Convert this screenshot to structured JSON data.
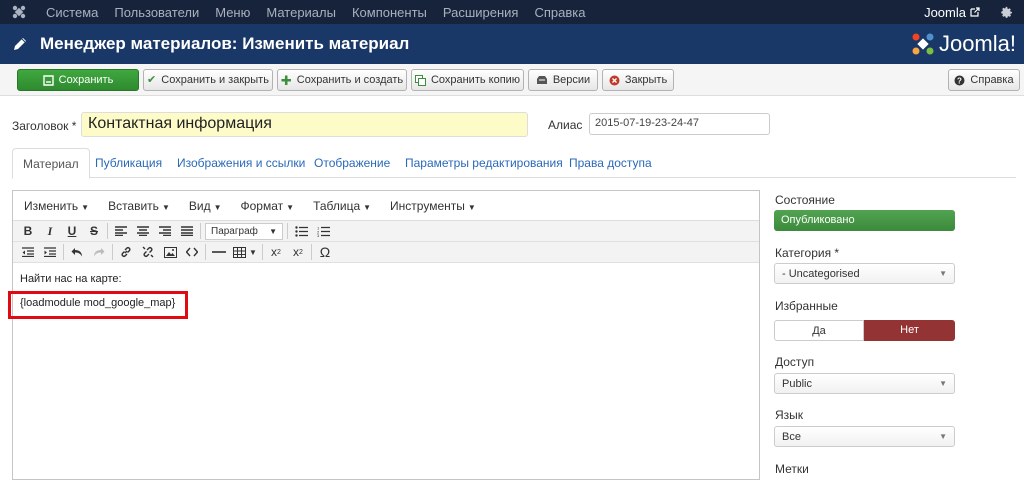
{
  "topnav": {
    "items": [
      "Система",
      "Пользователи",
      "Меню",
      "Материалы",
      "Компоненты",
      "Расширения",
      "Справка"
    ],
    "user_link": "Joomla"
  },
  "header": {
    "title": "Менеджер материалов: Изменить материал",
    "brand": "Joomla!"
  },
  "toolbar": {
    "save": "Сохранить",
    "save_close": "Сохранить и закрыть",
    "save_new": "Сохранить и создать",
    "save_copy": "Сохранить копию",
    "versions": "Версии",
    "close": "Закрыть",
    "help": "Справка"
  },
  "form": {
    "title_label": "Заголовок *",
    "title_value": "Контактная информация",
    "alias_label": "Алиас",
    "alias_value": "2015-07-19-23-24-47"
  },
  "tabs": [
    "Материал",
    "Публикация",
    "Изображения и ссылки",
    "Отображение",
    "Параметры редактирования",
    "Права доступа"
  ],
  "editor": {
    "menus": [
      "Изменить",
      "Вставить",
      "Вид",
      "Формат",
      "Таблица",
      "Инструменты"
    ],
    "format_value": "Параграф",
    "content_line1": "Найти нас на карте:",
    "content_line2": "{loadmodule mod_google_map}"
  },
  "sidebar": {
    "state_label": "Состояние",
    "state_value": "Опубликовано",
    "category_label": "Категория *",
    "category_value": "- Uncategorised",
    "featured_label": "Избранные",
    "featured_yes": "Да",
    "featured_no": "Нет",
    "access_label": "Доступ",
    "access_value": "Public",
    "language_label": "Язык",
    "language_value": "Все",
    "tags_label": "Метки"
  }
}
